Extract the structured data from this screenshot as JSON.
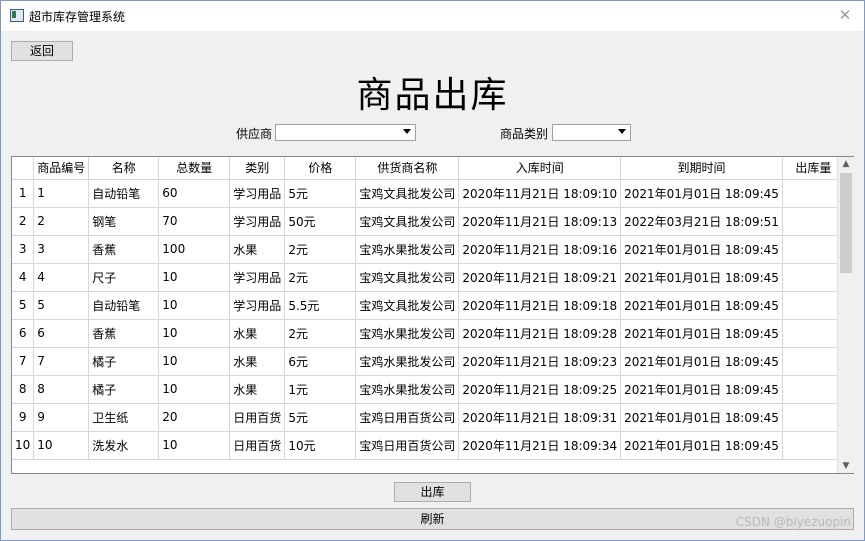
{
  "window": {
    "title": "超市库存管理系统",
    "close_glyph": "✕"
  },
  "back_button": "返回",
  "heading": "商品出库",
  "filters": {
    "supplier_label": "供应商",
    "supplier_value": "",
    "category_label": "商品类别",
    "category_value": ""
  },
  "table": {
    "columns": [
      "商品编号",
      "名称",
      "总数量",
      "类别",
      "价格",
      "供货商名称",
      "入库时间",
      "到期时间",
      "出库量"
    ],
    "rows": [
      {
        "n": "1",
        "id": "1",
        "name": "自动铅笔",
        "qty": "60",
        "cat": "学习用品",
        "price": "5元",
        "supplier": "宝鸡文具批发公司",
        "in": "2020年11月21日 18:09:10",
        "exp": "2021年01月01日 18:09:45",
        "out": ""
      },
      {
        "n": "2",
        "id": "2",
        "name": "钢笔",
        "qty": "70",
        "cat": "学习用品",
        "price": "50元",
        "supplier": "宝鸡文具批发公司",
        "in": "2020年11月21日 18:09:13",
        "exp": "2022年03月21日 18:09:51",
        "out": ""
      },
      {
        "n": "3",
        "id": "3",
        "name": "香蕉",
        "qty": "100",
        "cat": "水果",
        "price": "2元",
        "supplier": "宝鸡水果批发公司",
        "in": "2020年11月21日 18:09:16",
        "exp": "2021年01月01日 18:09:45",
        "out": ""
      },
      {
        "n": "4",
        "id": "4",
        "name": "尺子",
        "qty": "10",
        "cat": "学习用品",
        "price": "2元",
        "supplier": "宝鸡文具批发公司",
        "in": "2020年11月21日 18:09:21",
        "exp": "2021年01月01日 18:09:45",
        "out": ""
      },
      {
        "n": "5",
        "id": "5",
        "name": "自动铅笔",
        "qty": "10",
        "cat": "学习用品",
        "price": "5.5元",
        "supplier": "宝鸡文具批发公司",
        "in": "2020年11月21日 18:09:18",
        "exp": "2021年01月01日 18:09:45",
        "out": ""
      },
      {
        "n": "6",
        "id": "6",
        "name": "香蕉",
        "qty": "10",
        "cat": "水果",
        "price": "2元",
        "supplier": "宝鸡水果批发公司",
        "in": "2020年11月21日 18:09:28",
        "exp": "2021年01月01日 18:09:45",
        "out": ""
      },
      {
        "n": "7",
        "id": "7",
        "name": "橘子",
        "qty": "10",
        "cat": "水果",
        "price": "6元",
        "supplier": "宝鸡水果批发公司",
        "in": "2020年11月21日 18:09:23",
        "exp": "2021年01月01日 18:09:45",
        "out": ""
      },
      {
        "n": "8",
        "id": "8",
        "name": "橘子",
        "qty": "10",
        "cat": "水果",
        "price": "1元",
        "supplier": "宝鸡水果批发公司",
        "in": "2020年11月21日 18:09:25",
        "exp": "2021年01月01日 18:09:45",
        "out": ""
      },
      {
        "n": "9",
        "id": "9",
        "name": "卫生纸",
        "qty": "20",
        "cat": "日用百货",
        "price": "5元",
        "supplier": "宝鸡日用百货公司",
        "in": "2020年11月21日 18:09:31",
        "exp": "2021年01月01日 18:09:45",
        "out": ""
      },
      {
        "n": "10",
        "id": "10",
        "name": "洗发水",
        "qty": "10",
        "cat": "日用百货",
        "price": "10元",
        "supplier": "宝鸡日用百货公司",
        "in": "2020年11月21日 18:09:34",
        "exp": "2021年01月01日 18:09:45",
        "out": ""
      }
    ]
  },
  "scrollbar": {
    "up_glyph": "▲",
    "down_glyph": "▼"
  },
  "out_button": "出库",
  "refresh_button": "刷新",
  "watermark": "CSDN @biyezuopin"
}
